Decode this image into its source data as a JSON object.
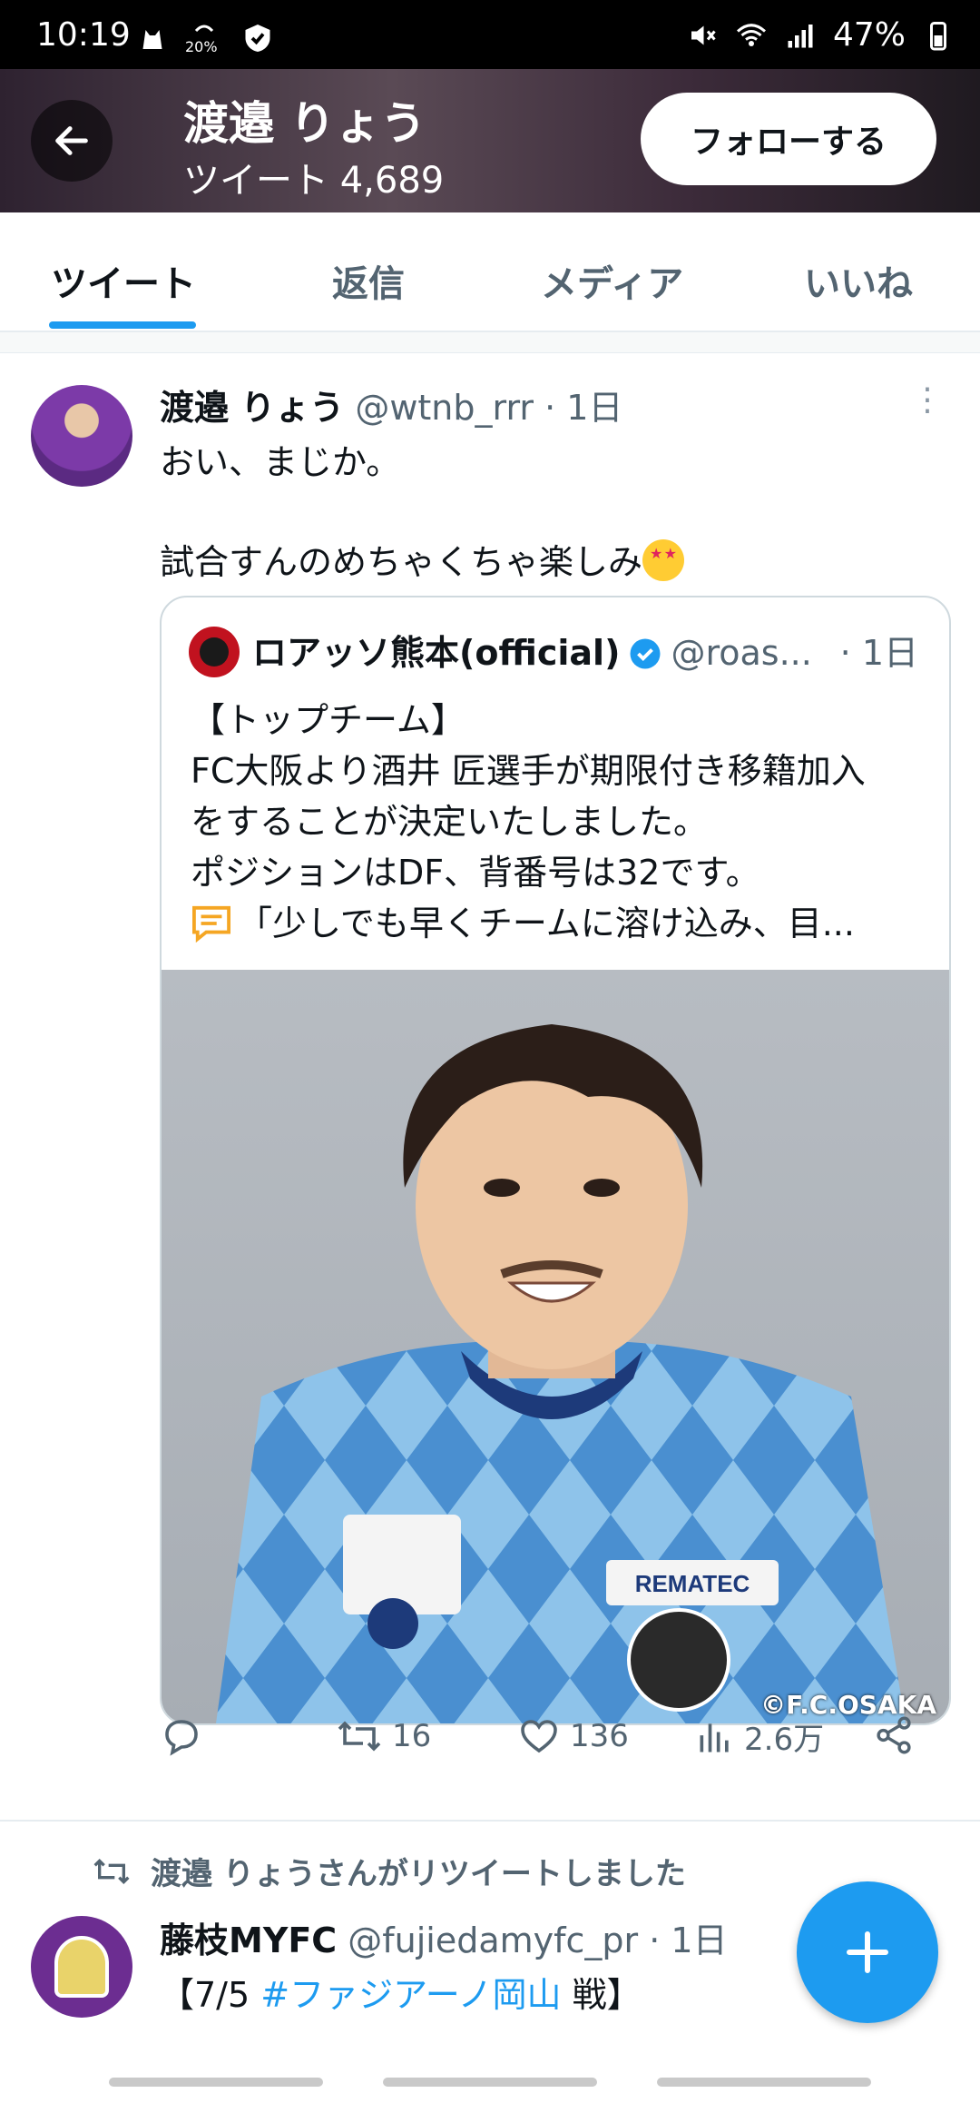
{
  "status_bar": {
    "time": "10:19",
    "data_label": "20%",
    "battery": "47%"
  },
  "header": {
    "name": "渡邉 りょう",
    "tweet_count": "ツイート 4,689",
    "follow_label": "フォローする"
  },
  "tabs": [
    {
      "label": "ツイート",
      "active": true
    },
    {
      "label": "返信",
      "active": false
    },
    {
      "label": "メディア",
      "active": false
    },
    {
      "label": "いいね",
      "active": false
    }
  ],
  "tweet": {
    "name": "渡邉 りょう",
    "handle": "@wtnb_rrr",
    "time": "· 1日",
    "lines": [
      "おい、まじか。",
      "試合すんのめちゃくちゃ楽しみ"
    ],
    "quote": {
      "name": "ロアッソ熊本(official)",
      "handle": "@roas...",
      "time": "· 1日",
      "lines": [
        "【トップチーム】",
        "FC大阪より酒井 匠選手が期限付き移籍加入",
        "をすることが決定いたしました。",
        "ポジションはDF、背番号は32です。",
        "「少しでも早くチームに溶け込み、目..."
      ],
      "photo_credit": "©F.C.OSAKA",
      "jersey_sponsor": "REMATEC"
    },
    "actions": {
      "retweets": "16",
      "likes": "136",
      "views": "2.6万"
    }
  },
  "retweet_note": "渡邉 りょうさんがリツイートしました",
  "tweet2": {
    "name": "藤枝MYFC",
    "handle": "@fujiedamyfc_pr",
    "time": "· 1日",
    "text_prefix": "【7/5 ",
    "hashtag": "#ファジアーノ岡山",
    "text_suffix": " 戦】"
  },
  "colors": {
    "accent": "#1d9bf0",
    "text": "#0f1419",
    "muted": "#536471"
  }
}
